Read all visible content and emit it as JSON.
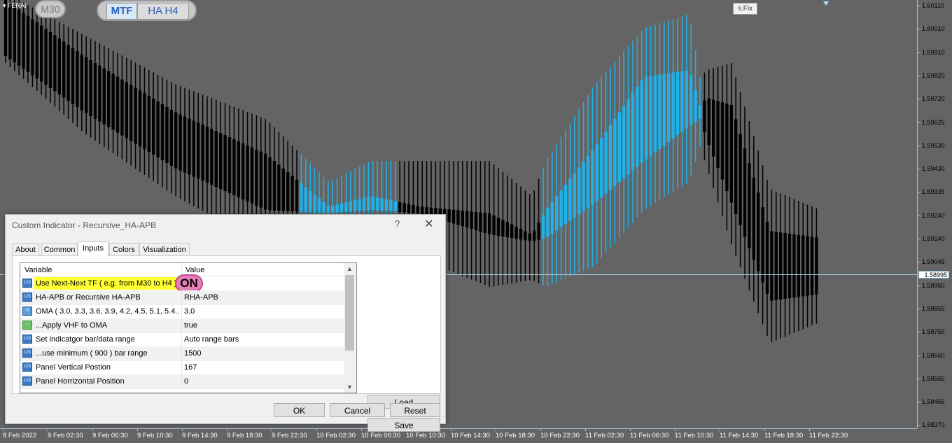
{
  "chart": {
    "symbol": "▾ FERAI",
    "timeframe_badge": "M30",
    "mtf_label": "MTF",
    "ha_label": "HA H4",
    "sfix_label": "s.Fix",
    "current_price": "1.58995",
    "price_labels": [
      "1.60110",
      "1.60010",
      "1.59910",
      "1.59820",
      "1.59720",
      "1.59625",
      "1.59530",
      "1.59430",
      "1.59335",
      "1.59240",
      "1.59140",
      "1.59045",
      "1.58950",
      "1.58855",
      "1.58755",
      "1.58660",
      "1.58565",
      "1.58465",
      "1.58370"
    ],
    "time_labels": [
      "8 Feb 2022",
      "9 Feb 02:30",
      "9 Feb 06:30",
      "9 Feb 10:30",
      "9 Feb 14:30",
      "9 Feb 18:30",
      "9 Feb 22:30",
      "10 Feb 02:30",
      "10 Feb 06:30",
      "10 Feb 10:30",
      "10 Feb 14:30",
      "10 Feb 18:30",
      "10 Feb 22:30",
      "11 Feb 02:30",
      "11 Feb 06:30",
      "11 Feb 10:30",
      "11 Feb 14:30",
      "11 Feb 18:30",
      "11 Feb 22:30"
    ],
    "colors": {
      "background": "#646464",
      "bear": "#000000",
      "bull": "#1fb1e9",
      "grid": "#a9c1d6"
    }
  },
  "dialog": {
    "title": "Custom Indicator - Recursive_HA-APB",
    "help": "?",
    "close": "✕",
    "tabs": [
      "About",
      "Common",
      "Inputs",
      "Colors",
      "Visualization"
    ],
    "active_tab": "Inputs",
    "grid": {
      "col_variable": "Variable",
      "col_value": "Value",
      "rows": [
        {
          "name": "Use Next-Next TF ( e.g. from M30  to  H4 )",
          "value": "ON",
          "icon": "123"
        },
        {
          "name": "HA-APB or Recursive HA-APB",
          "value": "RHA-APB",
          "icon": "123"
        },
        {
          "name": "OMA ( 3.0, 3.3, 3.6, 3.9, 4.2, 4.5, 5.1, 5.4...",
          "value": "3.0",
          "icon": "½"
        },
        {
          "name": "...Apply VHF to OMA",
          "value": "true",
          "icon": "~"
        },
        {
          "name": "Set indicatgor bar/data range",
          "value": "Auto range bars",
          "icon": "123"
        },
        {
          "name": "...use minimum ( 900 ) bar range",
          "value": "1500",
          "icon": "123"
        },
        {
          "name": "Panel Vertical Postion",
          "value": "167",
          "icon": "123"
        },
        {
          "name": "Panel Horrizontal Position",
          "value": "0",
          "icon": "123"
        }
      ]
    },
    "buttons": {
      "load": "Load",
      "save": "Save",
      "ok": "OK",
      "cancel": "Cancel",
      "reset": "Reset"
    }
  }
}
